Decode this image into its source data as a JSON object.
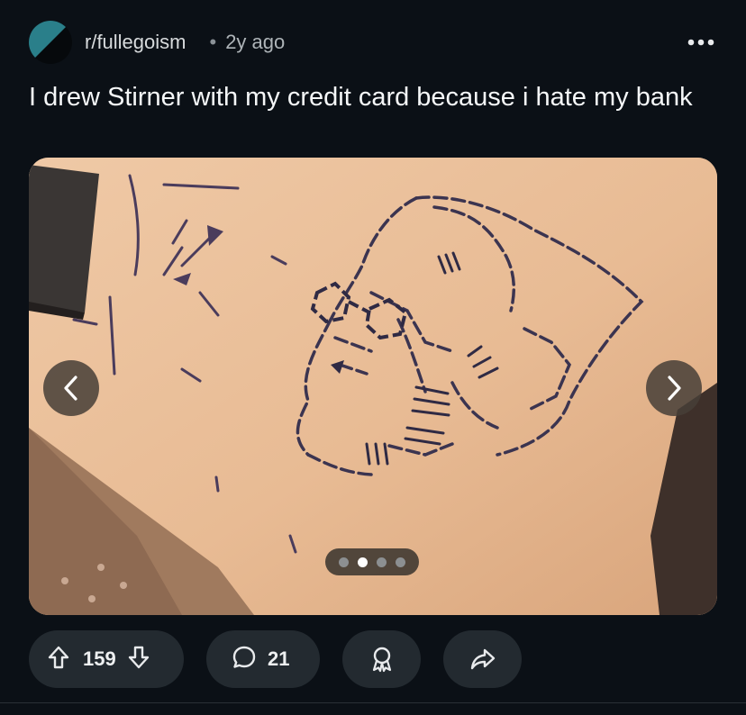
{
  "post": {
    "subreddit": "r/fullegoism",
    "separator": "•",
    "age": "2y ago",
    "title": "I drew Stirner with my credit card because i hate my bank",
    "gallery": {
      "current_index": 2,
      "total": 4,
      "alt": "Line drawing of Max Stirner made with a credit card on paper"
    }
  },
  "actions": {
    "score": "159",
    "comments": "21"
  },
  "icons": {
    "more": "more-options-icon",
    "upvote": "upvote-arrow-icon",
    "downvote": "downvote-arrow-icon",
    "comment": "comment-bubble-icon",
    "award": "award-icon",
    "share": "share-arrow-icon",
    "prev": "chevron-left-icon",
    "next": "chevron-right-icon"
  },
  "colors": {
    "background": "#0b1016",
    "pill": "#232a30",
    "avatar_teal": "#2a7f8a",
    "paper": "#e9bf98"
  }
}
